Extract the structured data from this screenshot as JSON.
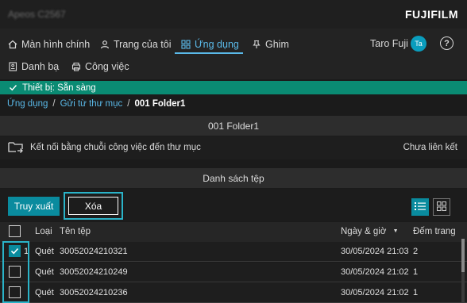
{
  "header": {
    "device_name": "Apeos C2567",
    "brand": "FUJIFILM"
  },
  "nav": {
    "row1": [
      {
        "label": "Màn hình chính",
        "icon": "home-icon",
        "active": false
      },
      {
        "label": "Trang của tôi",
        "icon": "person-icon",
        "active": false
      },
      {
        "label": "Ứng dụng",
        "icon": "apps-icon",
        "active": true
      },
      {
        "label": "Ghim",
        "icon": "pin-icon",
        "active": false
      }
    ],
    "row2": [
      {
        "label": "Danh bạ",
        "icon": "address-book-icon"
      },
      {
        "label": "Công việc",
        "icon": "printer-icon"
      }
    ],
    "user": {
      "name": "Taro Fuji",
      "initials": "Ta"
    },
    "help_label": "?"
  },
  "status": {
    "text": "Thiết bị: Sẵn sàng"
  },
  "breadcrumb": {
    "item1": "Ứng dụng",
    "item2": "Gửi từ thư mục",
    "current": "001 Folder1",
    "sep": "/"
  },
  "folder": {
    "title": "001 Folder1",
    "workflow_text": "Kết nối bằng chuỗi công việc đến thư mục",
    "workflow_status": "Chưa liên kết"
  },
  "file_list": {
    "title": "Danh sách tệp",
    "retrieve_label": "Truy xuất",
    "delete_label": "Xóa",
    "columns": {
      "type": "Loại",
      "name": "Tên tệp",
      "date": "Ngày & giờ",
      "pages": "Đếm trang"
    },
    "rows": [
      {
        "index": "1",
        "type": "Quét",
        "name": "30052024210321",
        "date": "30/05/2024 21:03",
        "pages": "2",
        "checked": true
      },
      {
        "index": "",
        "type": "Quét",
        "name": "30052024210249",
        "date": "30/05/2024 21:02",
        "pages": "1",
        "checked": false
      },
      {
        "index": "",
        "type": "Quét",
        "name": "30052024210236",
        "date": "30/05/2024 21:02",
        "pages": "1",
        "checked": false
      }
    ]
  },
  "colors": {
    "accent": "#5ab9e8",
    "status_bg": "#0a8b73",
    "button_bg": "#0a8b9e",
    "highlight": "#2ab3c8"
  }
}
